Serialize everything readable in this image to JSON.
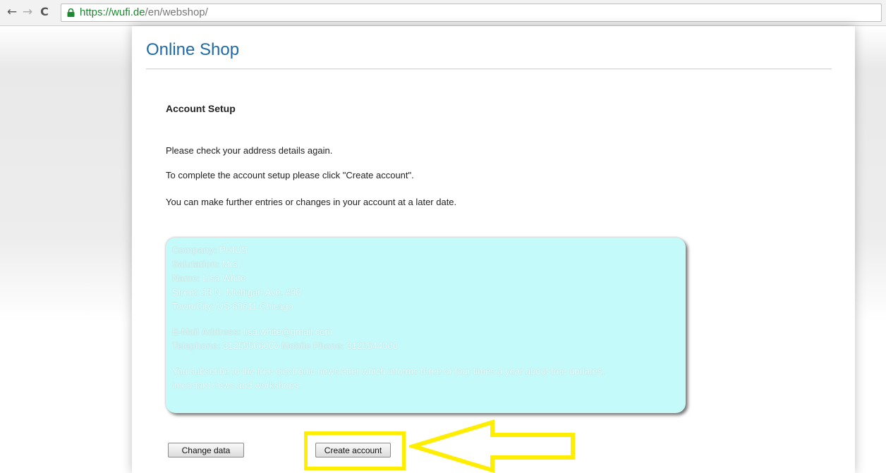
{
  "browser": {
    "url_scheme": "https://",
    "url_host": "wufi.de",
    "url_path": "/en/webshop/",
    "icons": [
      "back-arrow-icon",
      "forward-arrow-icon",
      "reload-icon",
      "lock-icon"
    ]
  },
  "page": {
    "title": "Online Shop",
    "section_heading": "Account Setup",
    "paragraphs": [
      "Please check your address details again.",
      "To complete the account setup please click \"Create account\".",
      "You can make further entries or changes in your account at a later date."
    ]
  },
  "address": {
    "company_label": "Company:",
    "company_value": "PHIUS",
    "salutation_label": "Salutation:",
    "salutation_value": "Mrs.",
    "name_label": "Name:",
    "name_value": "Lisa White",
    "street_label": "Street:",
    "street_value": "53 N. Michigan Ave. #90",
    "city_label": "Town/City:",
    "city_value": "US 60611 Chicago",
    "email_label": "E-Mail Address:",
    "email_value": "lisa.white@gmail.com",
    "phone_label": "Telephone:",
    "phone_value": "31255566000",
    "mobile_label": "Mobile Phone:",
    "mobile_value": "3125544000",
    "newsletter_line1": "You subscribe to the free electronic newsletter which informs three or four times a year about free updates,",
    "newsletter_line2": "important news and workshops."
  },
  "actions": {
    "change_label": "Change data",
    "create_label": "Create account"
  },
  "annotation": {
    "highlight_color": "#ffee00"
  },
  "colors": {
    "title": "#1f6aa5",
    "address_box": "#c5fafa",
    "url_secure": "#1a8a2e"
  }
}
